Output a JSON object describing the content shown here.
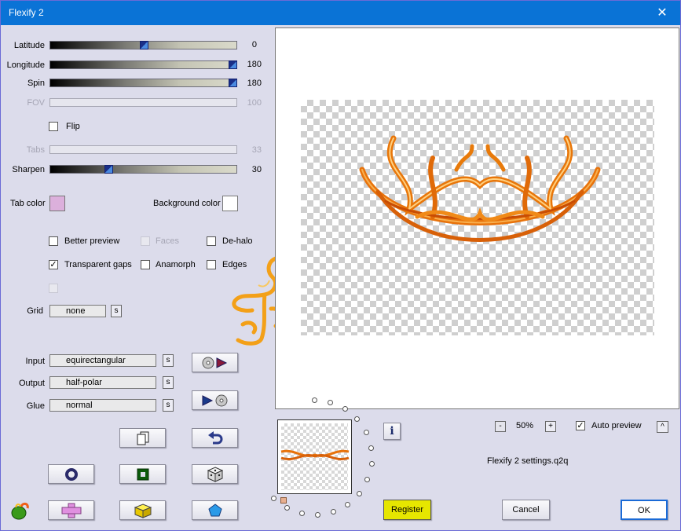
{
  "window": {
    "title": "Flexify 2",
    "close_glyph": "✕"
  },
  "sliders": {
    "latitude": {
      "label": "Latitude",
      "value": "0",
      "level": 0.5
    },
    "longitude": {
      "label": "Longitude",
      "value": "180",
      "level": 1.0
    },
    "spin": {
      "label": "Spin",
      "value": "180",
      "level": 1.0
    },
    "fov": {
      "label": "FOV",
      "value": "100"
    },
    "tabs": {
      "label": "Tabs",
      "value": "33"
    },
    "sharpen": {
      "label": "Sharpen",
      "value": "30",
      "level": 0.31
    }
  },
  "flip": {
    "label": "Flip",
    "checked": false
  },
  "colors": {
    "tab_color_label": "Tab color",
    "tab_color": "#dcb0dc",
    "background_color_label": "Background color",
    "background_color": "#ffffff"
  },
  "options": {
    "better_preview": {
      "label": "Better preview",
      "checked": false
    },
    "faces": {
      "label": "Faces",
      "checked": false
    },
    "de_halo": {
      "label": "De-halo",
      "checked": false
    },
    "transparent_gaps": {
      "label": "Transparent gaps",
      "checked": true
    },
    "anamorph": {
      "label": "Anamorph",
      "checked": false
    },
    "edges": {
      "label": "Edges",
      "checked": false
    }
  },
  "grid": {
    "label": "Grid",
    "value": "none",
    "s": "s"
  },
  "projections": {
    "input": {
      "label": "Input",
      "value": "equirectangular",
      "s": "s"
    },
    "output": {
      "label": "Output",
      "value": "half-polar",
      "s": "s"
    },
    "glue": {
      "label": "Glue",
      "value": "normal",
      "s": "s"
    }
  },
  "zoom": {
    "minus": "-",
    "value": "50%",
    "plus": "+"
  },
  "auto_preview": {
    "label": "Auto preview",
    "checked": true,
    "arrow": "^"
  },
  "settings_file": "Flexify 2 settings.q2q",
  "info_glyph": "i",
  "buttons": {
    "register": "Register",
    "cancel": "Cancel",
    "ok": "OK"
  },
  "accent": {
    "register_bg": "#e6e600",
    "title_bg": "#0a73d6",
    "ok_border": "#1a6ad6"
  }
}
